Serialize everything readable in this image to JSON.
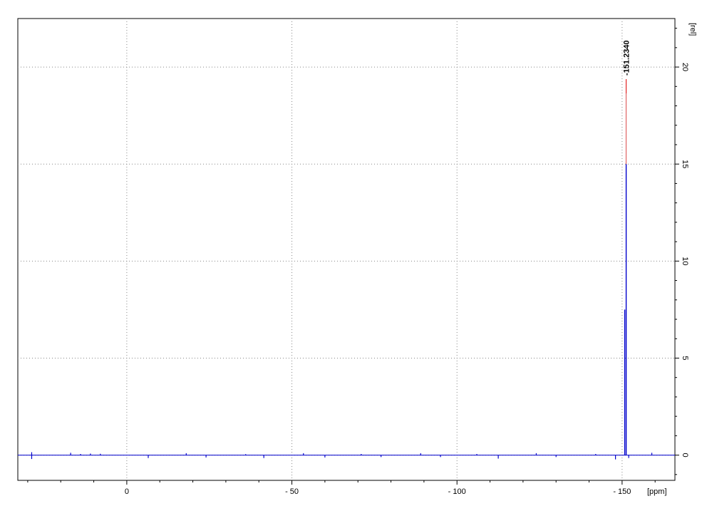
{
  "chart_data": {
    "type": "line",
    "x_axis": {
      "unit_label": "[ppm]",
      "range": [
        33,
        -166
      ],
      "reversed": true,
      "ticks": [
        0,
        -50,
        -100,
        -150
      ],
      "tick_labels": [
        "0",
        "- 50",
        "- 100",
        "- 150"
      ]
    },
    "y_axis": {
      "unit_label": "[rel]",
      "range": [
        -1.3,
        22.5
      ],
      "ticks": [
        0,
        5,
        10,
        15,
        20
      ],
      "tick_labels": [
        "0",
        "5",
        "10",
        "15",
        "20"
      ],
      "position": "right"
    },
    "grid": "dotted",
    "series": [
      {
        "color": "#0000cc",
        "baseline": 0,
        "peaks": [
          {
            "x": -151.234,
            "y": 15.0
          },
          {
            "x": -150.8,
            "y": 7.5
          }
        ],
        "noise": [
          {
            "x": 28.8,
            "y": 0.15
          },
          {
            "x": 28.8,
            "y": -0.2
          },
          {
            "x": 17,
            "y": 0.12
          },
          {
            "x": 14,
            "y": 0.06
          },
          {
            "x": 11,
            "y": 0.08
          },
          {
            "x": 8,
            "y": 0.07
          },
          {
            "x": -6.5,
            "y": -0.15
          },
          {
            "x": -18,
            "y": 0.1
          },
          {
            "x": -24,
            "y": -0.12
          },
          {
            "x": -36,
            "y": 0.05
          },
          {
            "x": -41.5,
            "y": -0.15
          },
          {
            "x": -53.5,
            "y": 0.1
          },
          {
            "x": -60,
            "y": -0.12
          },
          {
            "x": -71,
            "y": 0.06
          },
          {
            "x": -77,
            "y": -0.1
          },
          {
            "x": -89,
            "y": 0.1
          },
          {
            "x": -95,
            "y": -0.1
          },
          {
            "x": -106,
            "y": 0.06
          },
          {
            "x": -112.5,
            "y": -0.18
          },
          {
            "x": -124,
            "y": 0.1
          },
          {
            "x": -130,
            "y": -0.1
          },
          {
            "x": -142,
            "y": 0.06
          },
          {
            "x": -148,
            "y": -0.22
          },
          {
            "x": -152,
            "y": -0.15
          },
          {
            "x": -159,
            "y": 0.12
          }
        ]
      }
    ],
    "peak_labels": [
      {
        "text": "-151.2340",
        "x": -151.234,
        "color": "#dd0000"
      }
    ]
  }
}
